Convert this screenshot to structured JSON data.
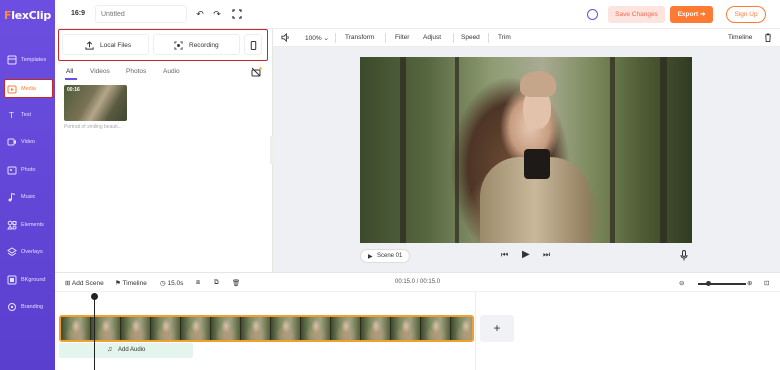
{
  "app": {
    "brand_prefix": "F",
    "brand_rest": "lexClip"
  },
  "sidebar": {
    "items": [
      {
        "label": "Templates",
        "icon": "templates-icon"
      },
      {
        "label": "Media",
        "icon": "media-icon",
        "active": true
      },
      {
        "label": "Text",
        "icon": "text-icon"
      },
      {
        "label": "Video",
        "icon": "video-icon"
      },
      {
        "label": "Photo",
        "icon": "photo-icon"
      },
      {
        "label": "Music",
        "icon": "music-icon"
      },
      {
        "label": "Elements",
        "icon": "elements-icon"
      },
      {
        "label": "Overlays",
        "icon": "overlays-icon"
      },
      {
        "label": "BKground",
        "icon": "background-icon"
      },
      {
        "label": "Branding",
        "icon": "branding-icon"
      }
    ]
  },
  "topbar": {
    "ratio": "16:9",
    "title_placeholder": "Untitled",
    "save_label": "Save Changes",
    "export_label": "Export",
    "signup_label": "Sign Up"
  },
  "media_panel": {
    "local_files_label": "Local Files",
    "recording_label": "Recording",
    "tabs": [
      "All",
      "Videos",
      "Photos",
      "Audio"
    ],
    "active_tab": "All",
    "thumb_duration": "00:16",
    "thumb_caption": "Portrait of smiling beauti..."
  },
  "edit_toolbar": {
    "zoom": "100%",
    "transform": "Transform",
    "filter": "Filter",
    "adjust": "Adjust",
    "speed": "Speed",
    "trim": "Trim",
    "timeline": "Timeline"
  },
  "player": {
    "scene_label": "Scene 01"
  },
  "timeline": {
    "add_scene": "Add Scene",
    "timeline_label": "Timeline",
    "duration": "15.0s",
    "time_display": "00:15.0 / 00:15.0",
    "add_audio": "Add Audio",
    "add_scene_symbol": "+"
  },
  "colors": {
    "brand_purple": "#6c4fe0",
    "accent_orange": "#ff7a33",
    "highlight_red": "#c62828"
  }
}
